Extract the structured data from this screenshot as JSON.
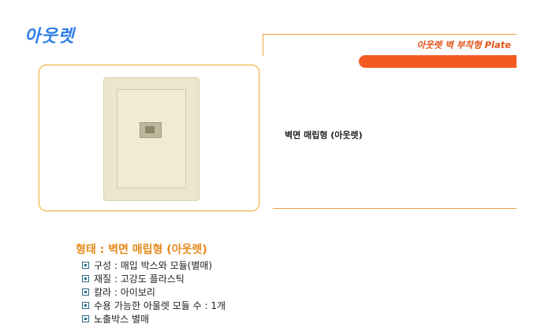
{
  "page": {
    "title": "아웃렛",
    "header_label": "아웃렛 벽 부착형 Plate"
  },
  "product": {
    "name": "벽면 매립형 (아웃렛)",
    "image_alt": "outlet wall plate"
  },
  "specs": {
    "title": "형태 : 벽면 매립형 (아웃렛)",
    "items": [
      "구성 : 매입 박스와 모듈(별매)",
      "재질 : 고강도 플라스틱",
      "칼라 : 아이보리",
      "수용 가능한 아울렛 모듈 수 : 1개",
      "노출박스 별매"
    ]
  },
  "colors": {
    "title": "#2f7fe8",
    "accent": "#f25a22",
    "border": "#f0a040",
    "spec_title": "#e78a1c"
  }
}
